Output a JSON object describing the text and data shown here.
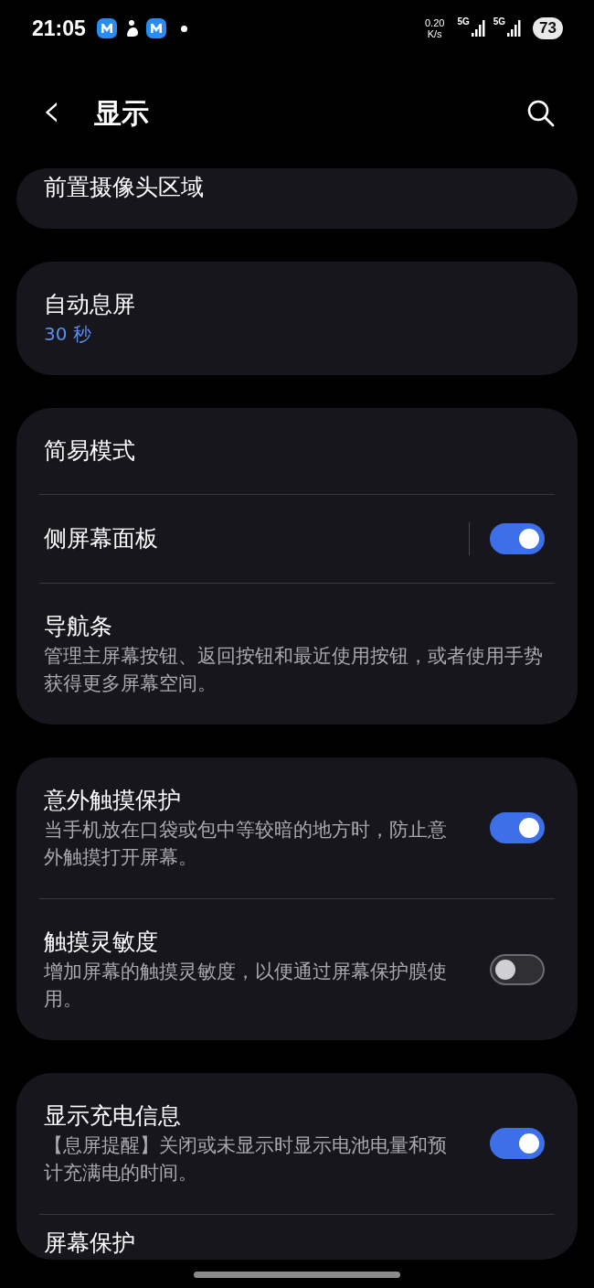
{
  "status_bar": {
    "time": "21:05",
    "net_speed": "0.20",
    "net_unit": "K/s",
    "sim1": "5G",
    "sim2": "5G",
    "battery": "73"
  },
  "header": {
    "back": "‹",
    "title": "显示"
  },
  "groups": [
    {
      "items": [
        {
          "kind": "plain",
          "title": "前置摄像头区域"
        }
      ]
    },
    {
      "items": [
        {
          "kind": "value",
          "title": "自动息屏",
          "value": "30 秒"
        }
      ]
    },
    {
      "items": [
        {
          "kind": "plain",
          "title": "简易模式"
        },
        {
          "kind": "toggle",
          "title": "侧屏幕面板",
          "on": true,
          "split": true
        },
        {
          "kind": "plain",
          "title": "导航条",
          "description": "管理主屏幕按钮、返回按钮和最近使用按钮，或者使用手势获得更多屏幕空间。"
        }
      ]
    },
    {
      "items": [
        {
          "kind": "toggle",
          "title": "意外触摸保护",
          "description": "当手机放在口袋或包中等较暗的地方时，防止意外触摸打开屏幕。",
          "on": true
        },
        {
          "kind": "toggle",
          "title": "触摸灵敏度",
          "description": "增加屏幕的触摸灵敏度，以便通过屏幕保护膜使用。",
          "on": false
        }
      ]
    },
    {
      "items": [
        {
          "kind": "toggle",
          "title": "显示充电信息",
          "description": "【息屏提醒】关闭或未显示时显示电池电量和预计充满电的时间。",
          "on": true
        },
        {
          "kind": "plain",
          "title": "屏幕保护"
        }
      ]
    }
  ]
}
